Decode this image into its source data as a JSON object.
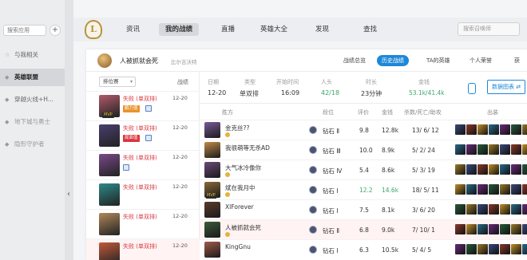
{
  "sidebar": {
    "search_placeholder": "搜索应用",
    "add_label": "+",
    "items": [
      {
        "label": "与我相关",
        "icon": "star-icon",
        "active": false,
        "dim": false
      },
      {
        "label": "英雄联盟",
        "icon": "lol-icon",
        "active": true,
        "dim": false
      },
      {
        "label": "穿越火线+H...",
        "icon": "cf-icon",
        "active": false,
        "dim": false
      },
      {
        "label": "地下城与勇士",
        "icon": "dnf-icon",
        "active": false,
        "dim": true
      },
      {
        "label": "隐形守护者",
        "icon": "game-icon",
        "active": false,
        "dim": true
      }
    ],
    "collapse_icon": "‹"
  },
  "topnav": {
    "logo_text": "L",
    "tabs": [
      "资讯",
      "我的战绩",
      "直播",
      "英雄大全",
      "发现",
      "查找"
    ],
    "active_tab": 1,
    "search_placeholder": "搜索召唤师"
  },
  "profile": {
    "summoner_name": "人被抓就会死",
    "server": "比尔吉沃特",
    "tabs": [
      "战绩总览",
      "历史战绩",
      "TA的英雄",
      "个人荣誉",
      "获"
    ],
    "active_tab": 1
  },
  "match_list": {
    "filter_label": "排位赛",
    "filter_arrow": "▾",
    "header_right": "战绩",
    "rows": [
      {
        "result": "失败 (单双排)",
        "date": "12-20",
        "badge": "躺力值",
        "badge_color": "#e8932c",
        "mvp": "MVP",
        "portrait": "#b05a6a"
      },
      {
        "result": "失败 (单双排)",
        "date": "12-20",
        "badge": "局面值",
        "badge_color": "#d9363e",
        "mvp": "",
        "portrait": "#4a3f6e"
      },
      {
        "result": "失败 (单双排)",
        "date": "12-20",
        "badge": "",
        "badge_color": "",
        "mvp": "",
        "portrait": "#7a4a8a"
      },
      {
        "result": "失败 (单双排)",
        "date": "12-20",
        "badge": "",
        "badge_color": "",
        "mvp": "",
        "portrait": "#2e8a8a"
      },
      {
        "result": "失败 (单双排)",
        "date": "12-20",
        "badge": "",
        "badge_color": "",
        "mvp": "",
        "portrait": "#b0885a"
      },
      {
        "result": "失败 (单双排)",
        "date": "12-20",
        "badge": "",
        "badge_color": "",
        "mvp": "",
        "portrait": "#c05a3a"
      }
    ]
  },
  "summary": {
    "date_label": "日期",
    "date": "12-20",
    "type_label": "类型",
    "type": "单双排",
    "start_label": "开始时间",
    "start": "16:09",
    "kills_label": "人头",
    "kills": "42/18",
    "duration_label": "时长",
    "duration": "23分钟",
    "gold_label": "金钱",
    "gold": "53.1k/41.4k",
    "detail_button": "数据图表 ⇄"
  },
  "team": {
    "headers": {
      "side": "胜方",
      "rank": "段位",
      "score": "评价",
      "gold": "金钱",
      "kda": "杀数/死亡/助攻",
      "items": "出装"
    },
    "rows": [
      {
        "name": "金克丝??",
        "rank": "钻石 Ⅱ",
        "score": "9.8",
        "gold": "12.8k",
        "kda": "13/ 6/ 12",
        "star": true,
        "mvp": "",
        "me": false,
        "highlight": false,
        "portrait": "#7a5a9a"
      },
      {
        "name": "我很萌等无杀AD",
        "rank": "钻石 Ⅲ",
        "score": "10.0",
        "gold": "8.9k",
        "kda": "5/ 2/ 24",
        "star": false,
        "mvp": "",
        "me": false,
        "highlight": false,
        "portrait": "#c08a4a"
      },
      {
        "name": "大气冰冷像你",
        "rank": "钻石 Ⅳ",
        "score": "5.4",
        "gold": "8.6k",
        "kda": "5/ 3/ 19",
        "star": true,
        "mvp": "",
        "me": false,
        "highlight": false,
        "portrait": "#6a4a7a"
      },
      {
        "name": "斌在我月中",
        "rank": "钻石 Ⅰ",
        "score": "12.2",
        "gold": "14.6k",
        "kda": "18/ 5/ 11",
        "star": true,
        "mvp": "MVP",
        "me": false,
        "highlight": true,
        "portrait": "#8a6a3a"
      },
      {
        "name": "XIForever",
        "rank": "钻石 Ⅰ",
        "score": "7.5",
        "gold": "8.1k",
        "kda": "3/ 6/ 20",
        "star": false,
        "mvp": "",
        "me": false,
        "highlight": false,
        "portrait": "#5a3a2a"
      },
      {
        "name": "人被抓就会死",
        "rank": "钻石 Ⅱ",
        "score": "6.8",
        "gold": "9.0k",
        "kda": "7/ 10/ 1",
        "star": true,
        "mvp": "",
        "me": true,
        "highlight": false,
        "portrait": "#3a5a3a"
      },
      {
        "name": "KingGnu",
        "rank": "钻石 Ⅰ",
        "score": "6.3",
        "gold": "10.5k",
        "kda": "5/ 4/ 5",
        "star": false,
        "mvp": "",
        "me": false,
        "highlight": false,
        "portrait": "#a05a4a"
      }
    ],
    "item_colors": [
      "#3a4a7a",
      "#8a3a2a",
      "#c0902a",
      "#2a6a8a",
      "#6a2a7a",
      "#2a5a3a",
      "#9a7a2a"
    ]
  },
  "colors": {
    "accent": "#1e88d8",
    "loss": "#d9363e",
    "win": "#3aa86b"
  }
}
